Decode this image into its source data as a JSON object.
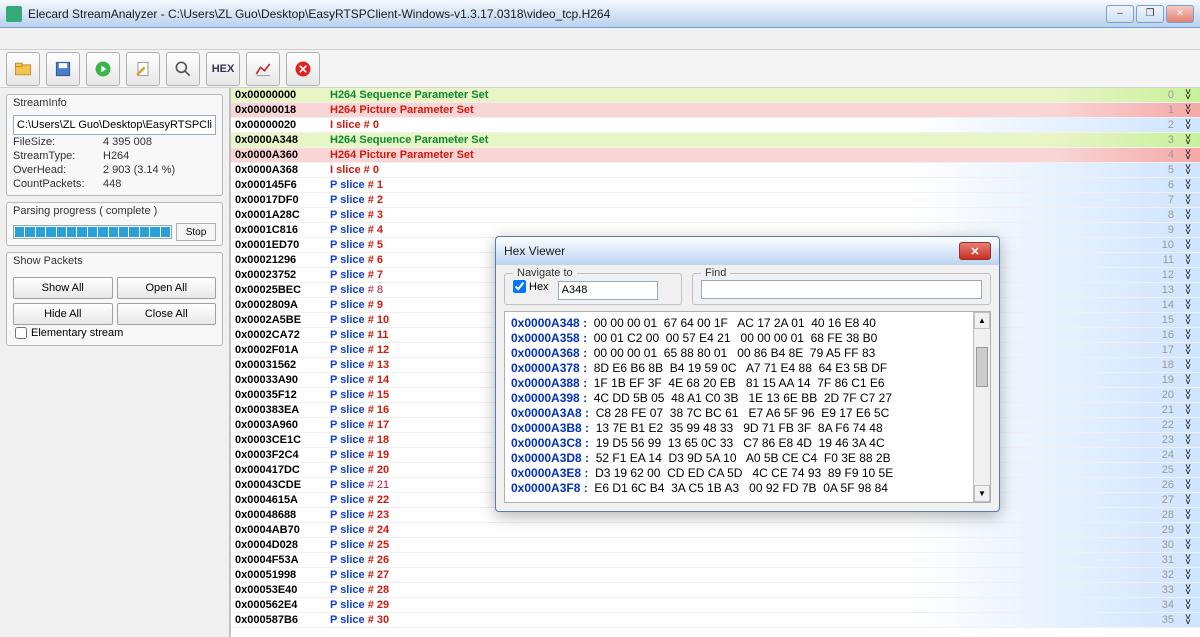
{
  "title": "Elecard StreamAnalyzer - C:\\Users\\ZL Guo\\Desktop\\EasyRTSPClient-Windows-v1.3.17.0318\\video_tcp.H264",
  "streaminfo": {
    "head": "StreamInfo",
    "path": "C:\\Users\\ZL Guo\\Desktop\\EasyRTSPClient-W",
    "rows": [
      {
        "k": "FileSize:",
        "v": "4 395 008"
      },
      {
        "k": "StreamType:",
        "v": "H264"
      },
      {
        "k": "OverHead:",
        "v": "2 903 (3.14 %)"
      },
      {
        "k": "CountPackets:",
        "v": "448"
      }
    ]
  },
  "progress": {
    "head": "Parsing progress ( complete )",
    "stop": "Stop"
  },
  "packets": {
    "head": "Show Packets",
    "showall": "Show All",
    "openall": "Open All",
    "hideall": "Hide All",
    "closeall": "Close All",
    "elem": "Elementary stream"
  },
  "rows": [
    {
      "off": "0x00000000",
      "t": "H264 Sequence Parameter Set",
      "c": "c-green",
      "bg": "bg-gy",
      "n": "0"
    },
    {
      "off": "0x00000018",
      "t": "H264 Picture Parameter Set",
      "c": "c-red",
      "bg": "bg-rd",
      "n": "1"
    },
    {
      "off": "0x00000020",
      "t": "I  slice   # 0",
      "c": "c-red",
      "bg": "bg-bl",
      "n": "2"
    },
    {
      "off": "0x0000A348",
      "t": "H264 Sequence Parameter Set",
      "c": "c-green",
      "bg": "bg-gy",
      "n": "3"
    },
    {
      "off": "0x0000A360",
      "t": "H264 Picture Parameter Set",
      "c": "c-red",
      "bg": "bg-rd",
      "n": "4"
    },
    {
      "off": "0x0000A368",
      "t": "I  slice   # 0",
      "c": "c-red",
      "bg": "bg-bl",
      "n": "5"
    },
    {
      "off": "0x000145F6",
      "t": "P slice   # 1",
      "c": "c-blue",
      "bg": "bg-bl",
      "n": "6"
    },
    {
      "off": "0x00017DF0",
      "t": "P slice   # 2",
      "c": "c-blue",
      "bg": "bg-bl",
      "n": "7"
    },
    {
      "off": "0x0001A28C",
      "t": "P slice   # 3",
      "c": "c-blue",
      "bg": "bg-bl",
      "n": "8"
    },
    {
      "off": "0x0001C816",
      "t": "P slice   # 4",
      "c": "c-blue",
      "bg": "bg-bl",
      "n": "9"
    },
    {
      "off": "0x0001ED70",
      "t": "P slice   # 5",
      "c": "c-blue",
      "bg": "bg-bl",
      "n": "10"
    },
    {
      "off": "0x00021296",
      "t": "P slice   # 6",
      "c": "c-blue",
      "bg": "bg-bl",
      "n": "11"
    },
    {
      "off": "0x00023752",
      "t": "P slice   # 7",
      "c": "c-blue",
      "bg": "bg-bl",
      "n": "12"
    },
    {
      "off": "0x00025BEC",
      "t": "   P slice   # 8",
      "c": "c-blue",
      "bg": "bg-bl",
      "n": "13",
      "dr": true
    },
    {
      "off": "0x0002809A",
      "t": "P slice   # 9",
      "c": "c-blue",
      "bg": "bg-bl",
      "n": "14"
    },
    {
      "off": "0x0002A5BE",
      "t": "P slice   # 10",
      "c": "c-blue",
      "bg": "bg-bl",
      "n": "15"
    },
    {
      "off": "0x0002CA72",
      "t": "P slice   # 11",
      "c": "c-blue",
      "bg": "bg-bl",
      "n": "16"
    },
    {
      "off": "0x0002F01A",
      "t": "P slice   # 12",
      "c": "c-blue",
      "bg": "bg-bl",
      "n": "17"
    },
    {
      "off": "0x00031562",
      "t": "P slice   # 13",
      "c": "c-blue",
      "bg": "bg-bl",
      "n": "18"
    },
    {
      "off": "0x00033A90",
      "t": "P slice   # 14",
      "c": "c-blue",
      "bg": "bg-bl",
      "n": "19"
    },
    {
      "off": "0x00035F12",
      "t": "P slice   # 15",
      "c": "c-blue",
      "bg": "bg-bl",
      "n": "20"
    },
    {
      "off": "0x000383EA",
      "t": "P slice   # 16",
      "c": "c-blue",
      "bg": "bg-bl",
      "n": "21"
    },
    {
      "off": "0x0003A960",
      "t": "P slice   # 17",
      "c": "c-blue",
      "bg": "bg-bl",
      "n": "22"
    },
    {
      "off": "0x0003CE1C",
      "t": "P slice   # 18",
      "c": "c-blue",
      "bg": "bg-bl",
      "n": "23"
    },
    {
      "off": "0x0003F2C4",
      "t": "P slice   # 19",
      "c": "c-blue",
      "bg": "bg-bl",
      "n": "24"
    },
    {
      "off": "0x000417DC",
      "t": "P slice   # 20",
      "c": "c-blue",
      "bg": "bg-bl",
      "n": "25"
    },
    {
      "off": "0x00043CDE",
      "t": "   P slice   # 21",
      "c": "c-blue",
      "bg": "bg-bl",
      "n": "26",
      "dr": true
    },
    {
      "off": "0x0004615A",
      "t": "P slice   # 22",
      "c": "c-blue",
      "bg": "bg-bl",
      "n": "27"
    },
    {
      "off": "0x00048688",
      "t": "P slice   # 23",
      "c": "c-blue",
      "bg": "bg-bl",
      "n": "28"
    },
    {
      "off": "0x0004AB70",
      "t": "P slice   # 24",
      "c": "c-blue",
      "bg": "bg-bl",
      "n": "29"
    },
    {
      "off": "0x0004D028",
      "t": "P slice   # 25",
      "c": "c-blue",
      "bg": "bg-bl",
      "n": "30"
    },
    {
      "off": "0x0004F53A",
      "t": "P slice   # 26",
      "c": "c-blue",
      "bg": "bg-bl",
      "n": "31"
    },
    {
      "off": "0x00051998",
      "t": "P slice   # 27",
      "c": "c-blue",
      "bg": "bg-bl",
      "n": "32"
    },
    {
      "off": "0x00053E40",
      "t": "P slice   # 28",
      "c": "c-blue",
      "bg": "bg-bl",
      "n": "33"
    },
    {
      "off": "0x000562E4",
      "t": "P slice   # 29",
      "c": "c-blue",
      "bg": "bg-bl",
      "n": "34"
    },
    {
      "off": "0x000587B6",
      "t": "P slice   # 30",
      "c": "c-blue",
      "bg": "bg-bl",
      "n": "35"
    }
  ],
  "hex": {
    "title": "Hex Viewer",
    "nav": "Navigate to",
    "hexlbl": "Hex",
    "hexval": "A348",
    "find": "Find",
    "lines": [
      {
        "a": "0x0000A348 :",
        "l": "00 00 00 01  67 64 00 1F",
        "r": "AC 17 2A 01  40 16 E8 40"
      },
      {
        "a": "0x0000A358 :",
        "l": "00 01 C2 00  00 57 E4 21",
        "r": "00 00 00 01  68 FE 38 B0"
      },
      {
        "a": "0x0000A368 :",
        "l": "00 00 00 01  65 88 80 01",
        "r": "00 86 B4 8E  79 A5 FF 83"
      },
      {
        "a": "0x0000A378 :",
        "l": "8D E6 B6 8B  B4 19 59 0C",
        "r": "A7 71 E4 88  64 E3 5B DF"
      },
      {
        "a": "0x0000A388 :",
        "l": "1F 1B EF 3F  4E 68 20 EB",
        "r": "81 15 AA 14  7F 86 C1 E6"
      },
      {
        "a": "0x0000A398 :",
        "l": "4C DD 5B 05  48 A1 C0 3B",
        "r": "1E 13 6E BB  2D 7F C7 27"
      },
      {
        "a": "0x0000A3A8 :",
        "l": "C8 28 FE 07  38 7C BC 61",
        "r": "E7 A6 5F 96  E9 17 E6 5C"
      },
      {
        "a": "0x0000A3B8 :",
        "l": "13 7E B1 E2  35 99 48 33",
        "r": "9D 71 FB 3F  8A F6 74 48"
      },
      {
        "a": "0x0000A3C8 :",
        "l": "19 D5 56 99  13 65 0C 33",
        "r": "C7 86 E8 4D  19 46 3A 4C"
      },
      {
        "a": "0x0000A3D8 :",
        "l": "52 F1 EA 14  D3 9D 5A 10",
        "r": "A0 5B CE C4  F0 3E 88 2B"
      },
      {
        "a": "0x0000A3E8 :",
        "l": "D3 19 62 00  CD ED CA 5D",
        "r": "4C CE 74 93  89 F9 10 5E"
      },
      {
        "a": "0x0000A3F8 :",
        "l": "E6 D1 6C B4  3A C5 1B A3",
        "r": "00 92 FD 7B  0A 5F 98 84"
      }
    ]
  }
}
